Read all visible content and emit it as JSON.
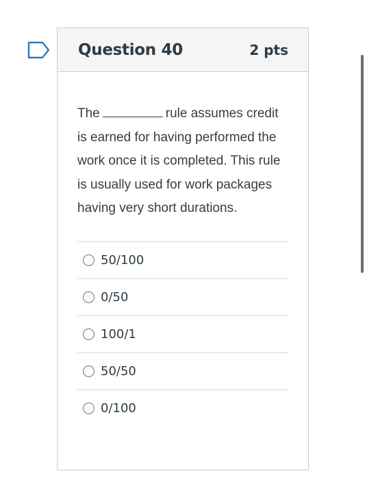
{
  "question": {
    "title": "Question 40",
    "points": "2 pts",
    "text_before_blank": "The",
    "text_after_blank": "rule assumes credit is earned for having performed the work once it is completed. This rule is usually used for work packages having very short durations."
  },
  "answers": [
    {
      "label": "50/100"
    },
    {
      "label": "0/50"
    },
    {
      "label": "100/1"
    },
    {
      "label": "50/50"
    },
    {
      "label": "0/100"
    }
  ],
  "icons": {
    "flag": "bookmark-flag-icon"
  },
  "colors": {
    "accent": "#2b7abc",
    "header_bg": "#f5f5f5",
    "border": "#c7cdd1",
    "title_text": "#2d3b45"
  }
}
